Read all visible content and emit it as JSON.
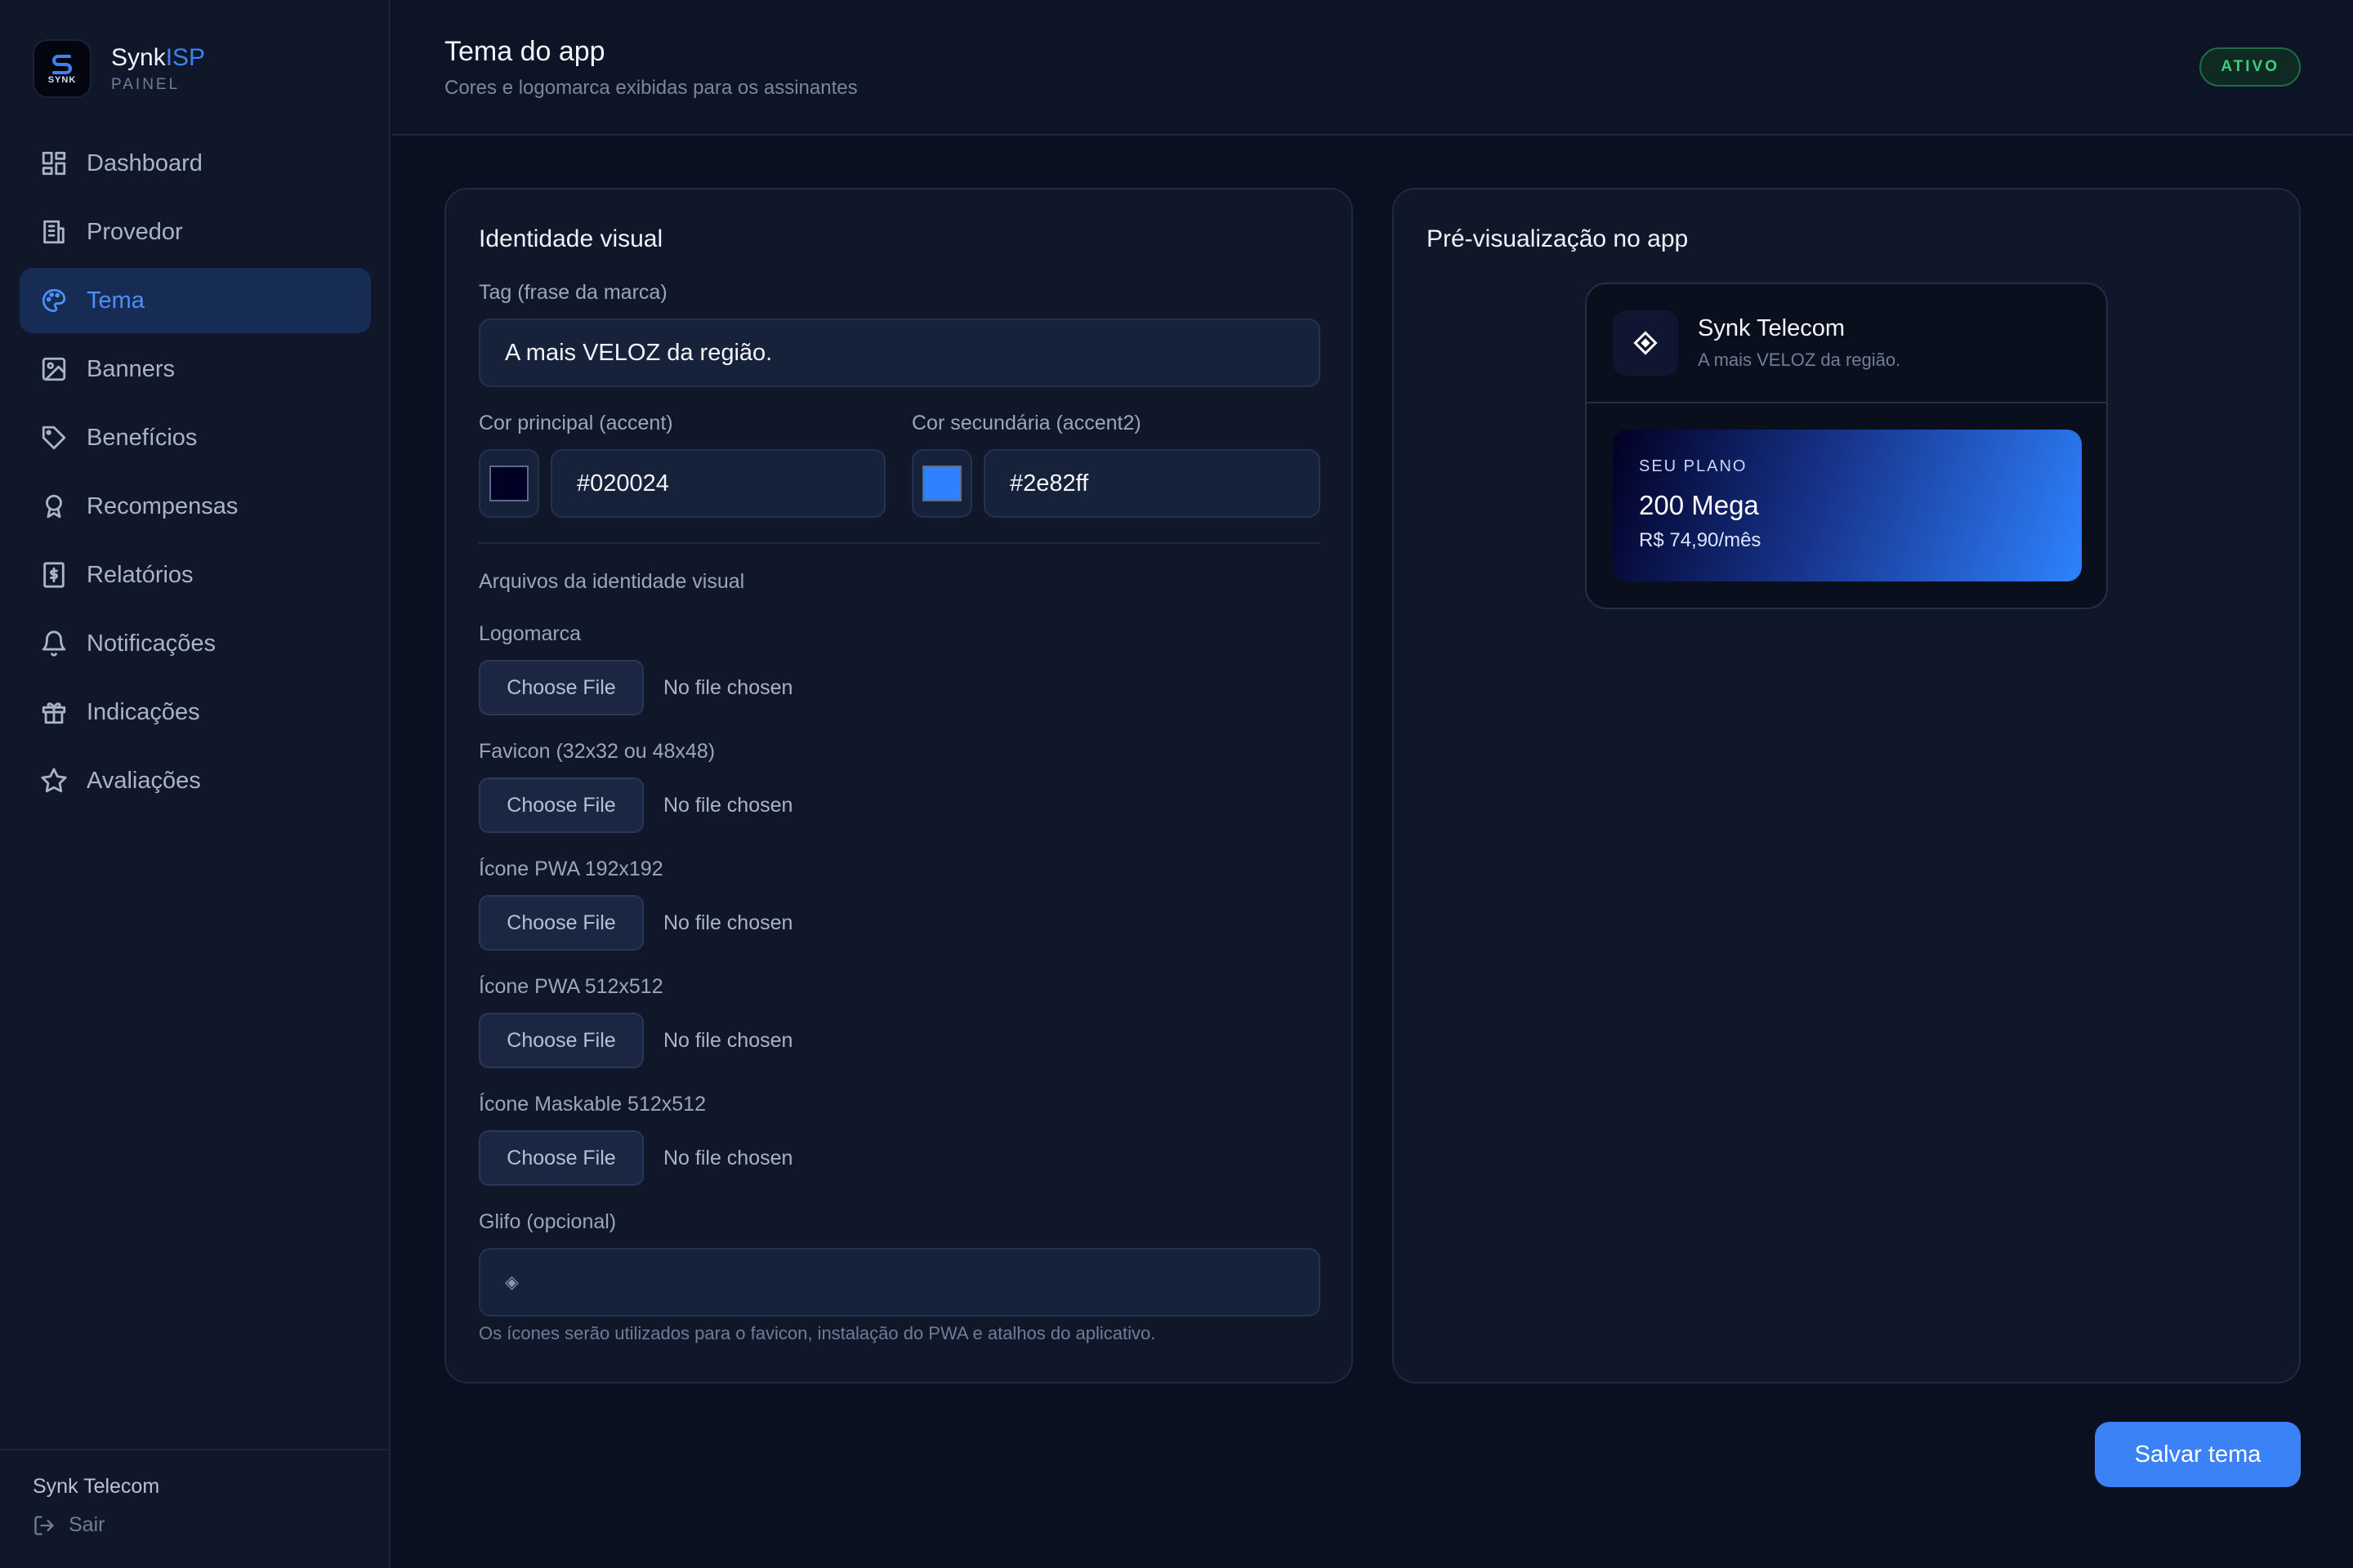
{
  "brand": {
    "name_primary": "Synk",
    "name_accent": "ISP",
    "subtitle": "PAINEL",
    "logo_text": "SYNK"
  },
  "nav": {
    "items": [
      {
        "label": "Dashboard",
        "icon": "dashboard-icon"
      },
      {
        "label": "Provedor",
        "icon": "building-icon"
      },
      {
        "label": "Tema",
        "icon": "palette-icon",
        "active": true
      },
      {
        "label": "Banners",
        "icon": "image-icon"
      },
      {
        "label": "Benefícios",
        "icon": "tag-icon"
      },
      {
        "label": "Recompensas",
        "icon": "award-icon"
      },
      {
        "label": "Relatórios",
        "icon": "receipt-icon"
      },
      {
        "label": "Notificações",
        "icon": "bell-icon"
      },
      {
        "label": "Indicações",
        "icon": "gift-icon"
      },
      {
        "label": "Avaliações",
        "icon": "star-icon"
      }
    ]
  },
  "footer": {
    "org_name": "Synk Telecom",
    "logout_label": "Sair"
  },
  "header": {
    "title": "Tema do app",
    "subtitle": "Cores e logomarca exibidas para os assinantes",
    "status_badge": "ATIVO"
  },
  "identity": {
    "title": "Identidade visual",
    "tag_label": "Tag (frase da marca)",
    "tag_value": "A mais VELOZ da região.",
    "accent_label": "Cor principal (accent)",
    "accent_value": "#020024",
    "accent2_label": "Cor secundária (accent2)",
    "accent2_value": "#2e82ff",
    "files_section_label": "Arquivos da identidade visual",
    "files": [
      {
        "label": "Logomarca",
        "button": "Choose File",
        "status": "No file chosen"
      },
      {
        "label": "Favicon (32x32 ou 48x48)",
        "button": "Choose File",
        "status": "No file chosen"
      },
      {
        "label": "Ícone PWA 192x192",
        "button": "Choose File",
        "status": "No file chosen"
      },
      {
        "label": "Ícone PWA 512x512",
        "button": "Choose File",
        "status": "No file chosen"
      },
      {
        "label": "Ícone Maskable 512x512",
        "button": "Choose File",
        "status": "No file chosen"
      }
    ],
    "glyph_label": "Glifo (opcional)",
    "glyph_value": "◈",
    "hint": "Os ícones serão utilizados para o favicon, instalação do PWA e atalhos do aplicativo."
  },
  "preview": {
    "title": "Pré-visualização no app",
    "app_name": "Synk Telecom",
    "app_tag": "A mais VELOZ da região.",
    "app_glyph": "◈",
    "plan_label": "SEU PLANO",
    "plan_name": "200 Mega",
    "plan_price": "R$ 74,90/mês"
  },
  "actions": {
    "save_label": "Salvar tema"
  },
  "colors": {
    "accent": "#020024",
    "accent2": "#2e82ff",
    "primary_button": "#3b82f6",
    "status_active": "#3ecf7e"
  }
}
